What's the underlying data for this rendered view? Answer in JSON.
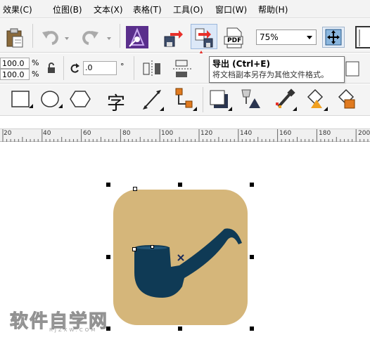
{
  "menu": {
    "items": [
      "效果(C)",
      "位图(B)",
      "文本(X)",
      "表格(T)",
      "工具(O)",
      "窗口(W)",
      "帮助(H)"
    ]
  },
  "toolbar": {
    "zoom_value": "75%",
    "pdf_label": "PDF"
  },
  "tooltip": {
    "title": "导出 (Ctrl+E)",
    "description": "将文档副本另存为其他文件格式。"
  },
  "property_bar": {
    "scale_x": "100.0",
    "scale_y": "100.0",
    "scale_unit": "%",
    "angle_value": ".0",
    "angle_unit": "°"
  },
  "toolbox": {
    "text_tool_glyph": "字"
  },
  "ruler": {
    "ticks": [
      "20",
      "40",
      "60",
      "80",
      "100",
      "120",
      "140",
      "160",
      "180",
      "200"
    ]
  },
  "watermark": {
    "text": "软件自学网",
    "url": "RJZXW.COM"
  },
  "colors": {
    "tile": "#d5b67a",
    "pipe": "#0f3a55",
    "arrow": "#e8302a",
    "purple": "#5a2f8c"
  }
}
